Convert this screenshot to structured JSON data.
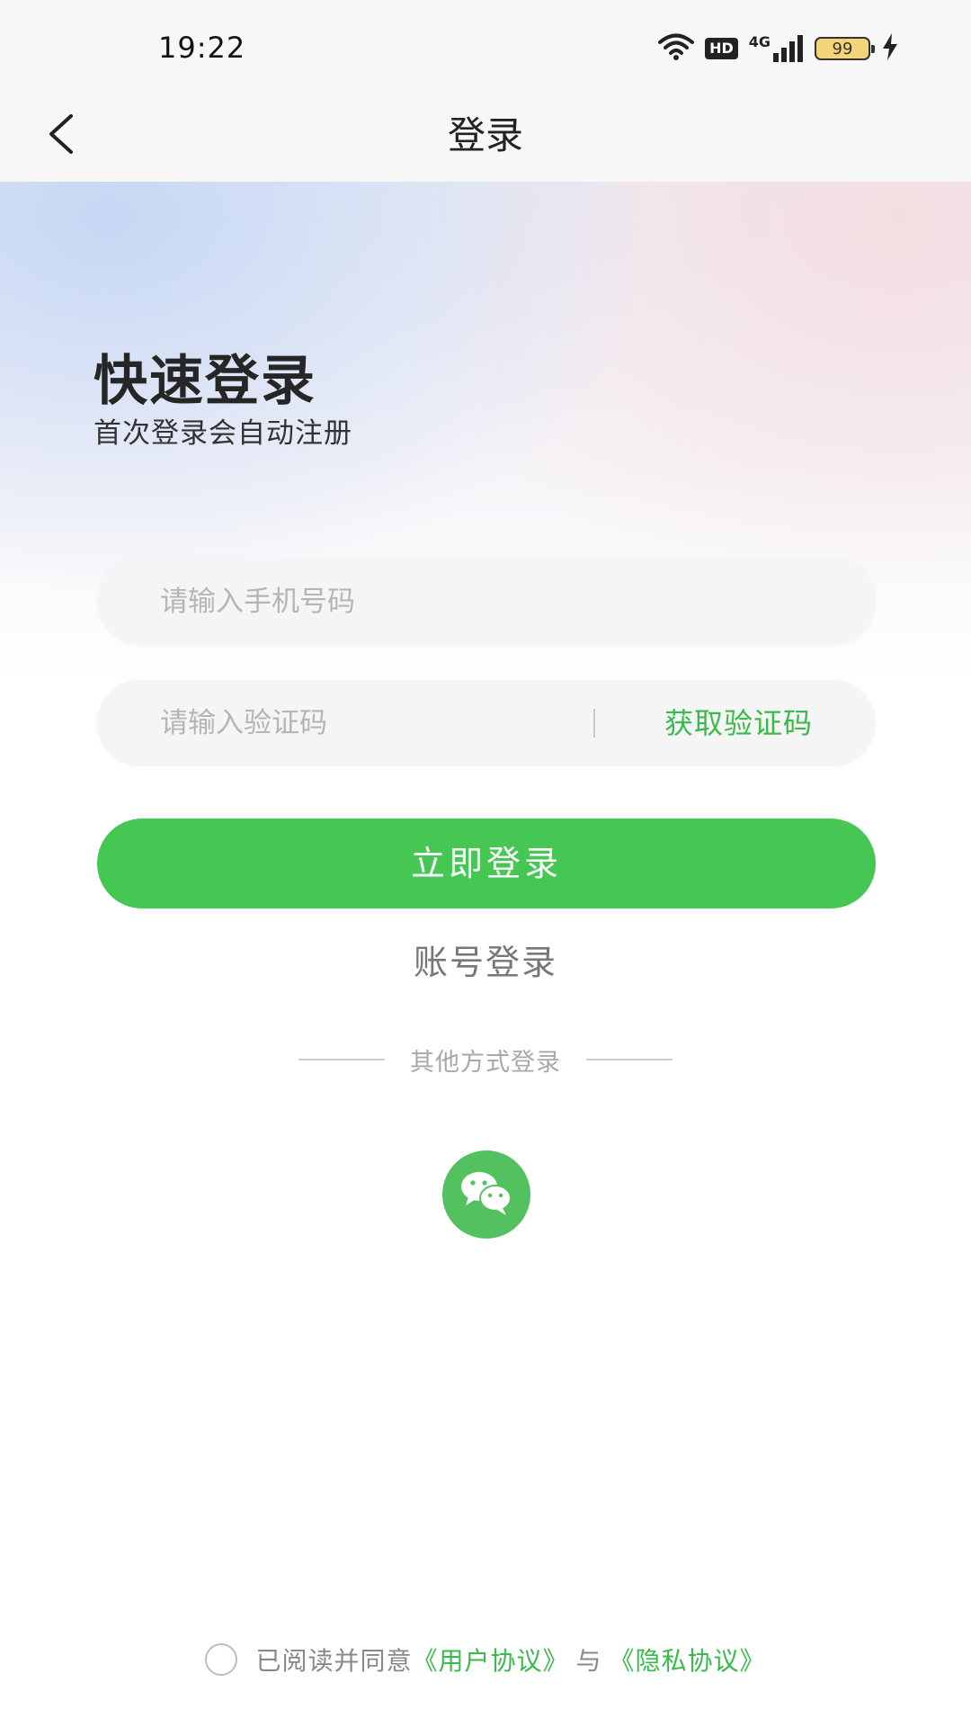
{
  "status_bar": {
    "time": "19:22",
    "icons": [
      "wifi-icon",
      "hd-badge",
      "signal-icon",
      "battery-icon",
      "charging-icon"
    ],
    "hd_label": "HD",
    "network_label": "4G",
    "battery_level": "99"
  },
  "nav": {
    "back_icon": "chevron-left-icon",
    "title": "登录"
  },
  "hero": {
    "title": "快速登录",
    "subtitle": "首次登录会自动注册"
  },
  "form": {
    "phone_placeholder": "请输入手机号码",
    "phone_value": "",
    "code_placeholder": "请输入验证码",
    "code_value": "",
    "get_code_label": "获取验证码",
    "login_label": "立即登录",
    "account_login_label": "账号登录"
  },
  "other_methods": {
    "label": "其他方式登录",
    "wechat_icon": "wechat-icon"
  },
  "agreement": {
    "checked": false,
    "prefix": "已阅读并同意",
    "user_agreement": "《用户协议》",
    "conjunction": "与",
    "privacy_policy": "《隐私协议》"
  },
  "colors": {
    "accent_green": "#46c653",
    "link_green": "#3bba4c",
    "input_bg": "#f5f5f5",
    "bar_bg": "#f7f7f7"
  }
}
